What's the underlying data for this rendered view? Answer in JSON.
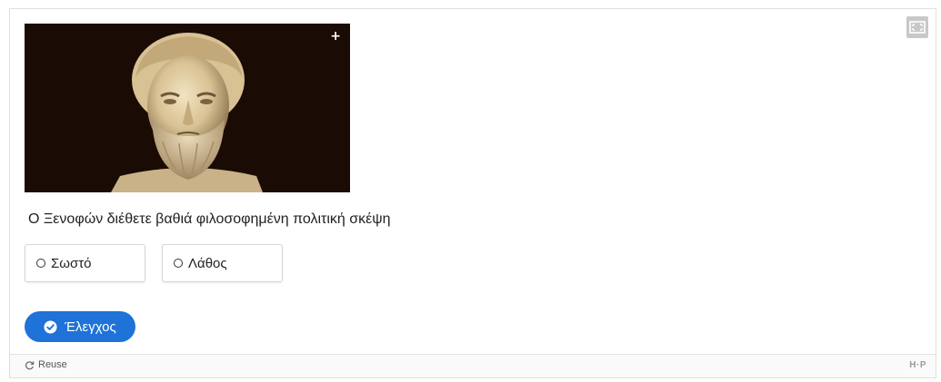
{
  "image": {
    "alt": "",
    "expand_label": "+"
  },
  "question": {
    "text": "Ο Ξενοφών διέθετε βαθιά φιλοσοφημένη πολιτική σκέψη"
  },
  "answers": [
    {
      "label": "Σωστό"
    },
    {
      "label": "Λάθος"
    }
  ],
  "actions": {
    "check_label": "Έλεγχος"
  },
  "footer": {
    "reuse_label": "Reuse",
    "logo_text": "H·P"
  },
  "colors": {
    "accent": "#1f72d7",
    "image_background": "#1a0b05"
  },
  "icons": {
    "fullscreen": "fullscreen-icon",
    "expand": "plus-icon",
    "check": "check-circle-icon",
    "reuse": "refresh-icon"
  }
}
